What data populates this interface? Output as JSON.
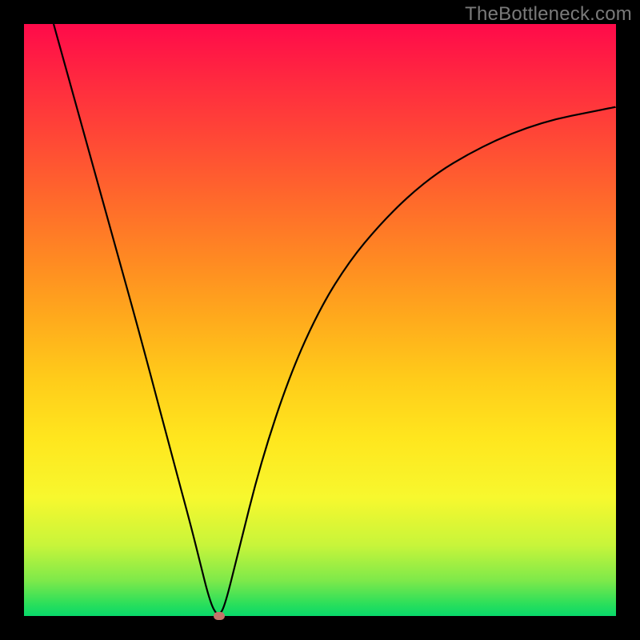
{
  "watermark": "TheBottleneck.com",
  "colors": {
    "background": "#000000",
    "curve": "#000000",
    "dot": "#c4746a",
    "gradient_top": "#ff0a4a",
    "gradient_bottom": "#08d86a"
  },
  "chart_data": {
    "type": "line",
    "title": "",
    "xlabel": "",
    "ylabel": "",
    "xlim": [
      0,
      100
    ],
    "ylim": [
      0,
      100
    ],
    "grid": false,
    "legend": false,
    "series": [
      {
        "name": "bottleneck-curve",
        "x": [
          5,
          10,
          15,
          20,
          25,
          28,
          30,
          31,
          32,
          33,
          34,
          36,
          40,
          45,
          50,
          55,
          60,
          65,
          70,
          75,
          80,
          85,
          90,
          95,
          100
        ],
        "values": [
          100,
          82,
          64,
          46,
          27,
          16,
          8,
          4,
          1,
          0,
          2,
          10,
          26,
          41,
          52,
          60,
          66,
          71,
          75,
          78,
          80.5,
          82.5,
          84,
          85,
          86
        ]
      }
    ],
    "annotations": [
      {
        "type": "point",
        "name": "minimum",
        "x": 33,
        "y": 0
      }
    ]
  }
}
